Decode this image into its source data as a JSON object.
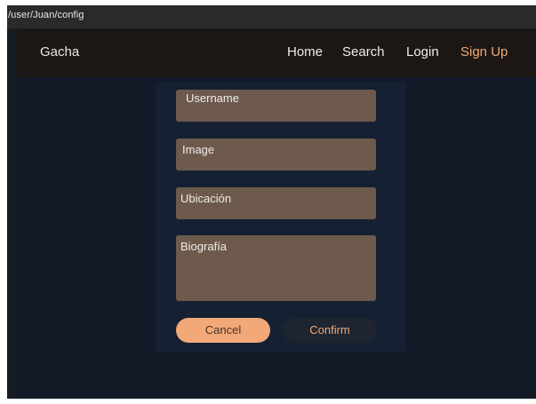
{
  "window": {
    "path": "/user/Juan/config"
  },
  "navbar": {
    "brand": "Gacha",
    "links": {
      "home": "Home",
      "search": "Search",
      "login": "Login",
      "signup": "Sign Up"
    }
  },
  "form": {
    "fields": {
      "username": "Username",
      "image": "Image",
      "ubicacion": "Ubicación",
      "biografia": "Biografía"
    },
    "buttons": {
      "cancel": "Cancel",
      "confirm": "Confirm"
    }
  },
  "colors": {
    "accent": "#f2a977",
    "field_bg": "#6d5a4d",
    "navbar_bg": "#1c1714",
    "page_bg": "#131a27",
    "panel_bg": "#152132"
  }
}
